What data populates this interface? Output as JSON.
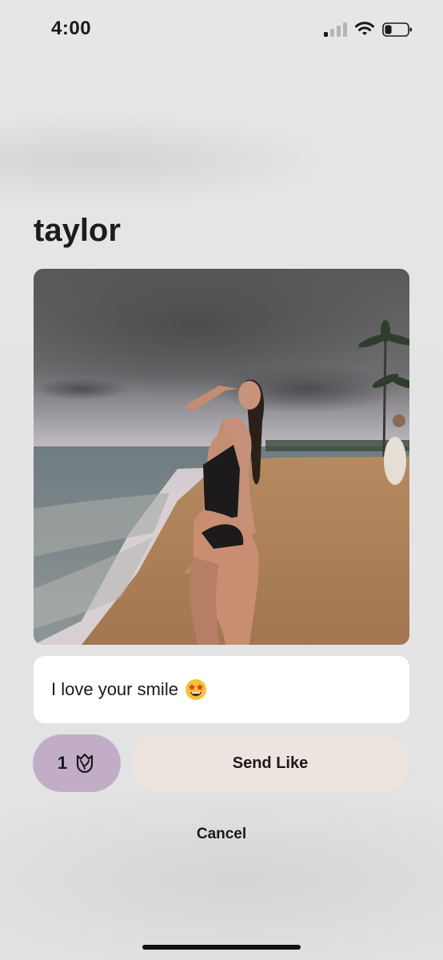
{
  "status_bar": {
    "time": "4:00",
    "signal_bars_active": 1,
    "signal_bars_total": 4,
    "battery_level": 0.3
  },
  "profile": {
    "name": "taylor"
  },
  "comment": {
    "text": "I love your smile",
    "emoji_icon": "star-struck-emoji-icon"
  },
  "actions": {
    "rose_count": "1",
    "rose_icon": "rose-icon",
    "send_label": "Send Like",
    "cancel_label": "Cancel"
  },
  "colors": {
    "rose_button": "#c2adc6",
    "send_button": "#ede3df",
    "background": "#e4e4e4"
  }
}
